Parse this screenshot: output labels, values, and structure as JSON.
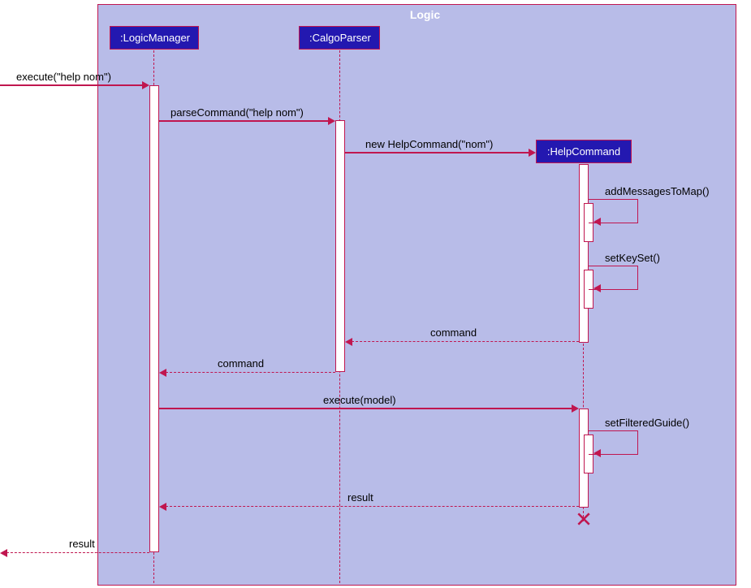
{
  "frame": {
    "title": "Logic"
  },
  "participants": {
    "p1": ":LogicManager",
    "p2": ":CalgoParser",
    "p3": ":HelpCommand"
  },
  "messages": {
    "m1": "execute(\"help nom\")",
    "m2": "parseCommand(\"help nom\")",
    "m3": "new HelpCommand(\"nom\")",
    "m4": "addMessagesToMap()",
    "m5": "setKeySet()",
    "m6": "command",
    "m7": "command",
    "m8": "execute(model)",
    "m9": "setFilteredGuide()",
    "m10": "result",
    "m11": "result"
  }
}
